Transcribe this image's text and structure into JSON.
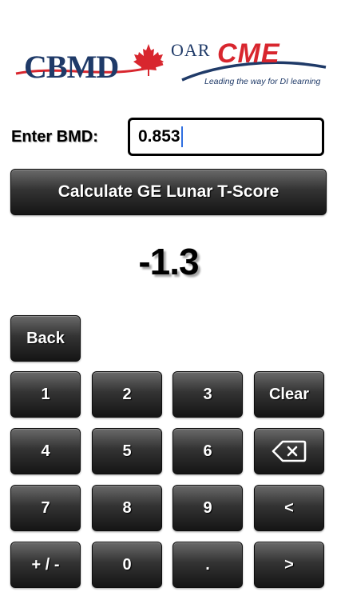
{
  "logos": {
    "cbmd": {
      "text": "CBMD",
      "icon": "maple-leaf-icon",
      "color": "#1f3a68",
      "accent": "#d8262e"
    },
    "oarcme": {
      "prefix": "OAR",
      "name": "CME",
      "tagline": "Leading the way for DI learning",
      "color": "#d8262e",
      "prefix_color": "#1f3a68"
    }
  },
  "input": {
    "label": "Enter BMD:",
    "value": "0.853"
  },
  "calculate_button": {
    "label": "Calculate GE Lunar T-Score"
  },
  "result": {
    "value": "-1.3"
  },
  "keypad": {
    "back": "Back",
    "row1": [
      "1",
      "2",
      "3",
      "Clear"
    ],
    "row2": [
      "4",
      "5",
      "6"
    ],
    "backspace_icon": "backspace-icon",
    "row3": [
      "7",
      "8",
      "9",
      "<"
    ],
    "row4": [
      "+ / -",
      "0",
      ".",
      ">"
    ]
  }
}
